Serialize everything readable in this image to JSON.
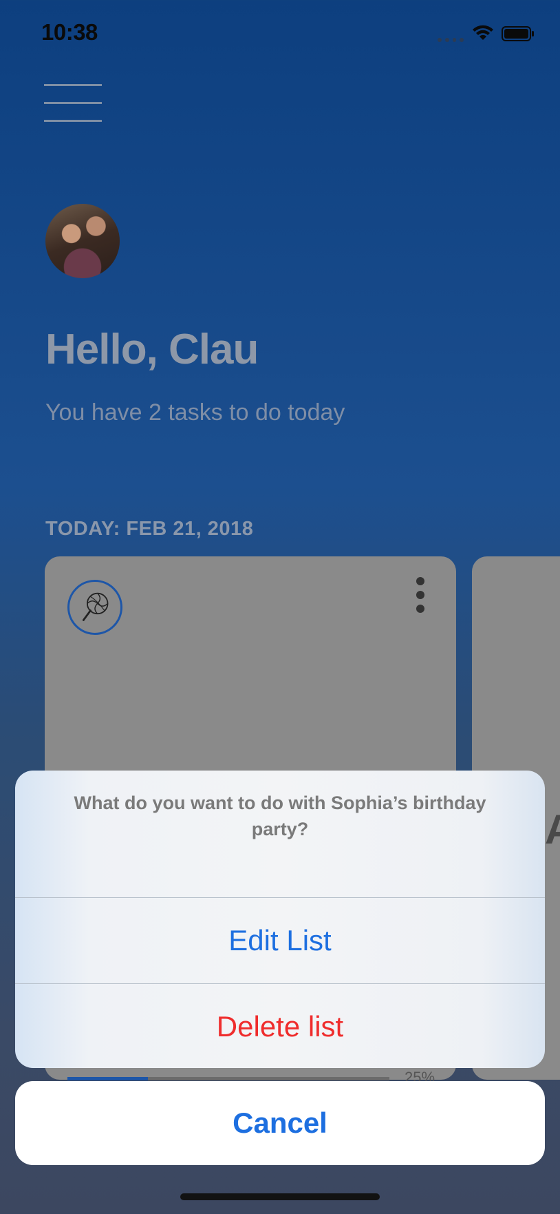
{
  "status_bar": {
    "time": "10:38"
  },
  "header": {
    "greeting": "Hello, Clau",
    "subtitle": "You have 2 tasks to do today",
    "date_label": "TODAY: FEB 21, 2018"
  },
  "card": {
    "icon": "lollipop-icon",
    "progress_fraction": 0.25,
    "progress_label": "25%",
    "next_card_letter": "A"
  },
  "action_sheet": {
    "title": "What do you want to do with Sophia’s birthday party?",
    "actions": [
      {
        "label": "Edit List",
        "style": "default"
      },
      {
        "label": "Delete list",
        "style": "destructive"
      }
    ],
    "cancel_label": "Cancel"
  },
  "colors": {
    "accent_blue": "#1d6fe0",
    "destructive_red": "#ef2d2d",
    "header_blue": "#0d3f7f"
  }
}
